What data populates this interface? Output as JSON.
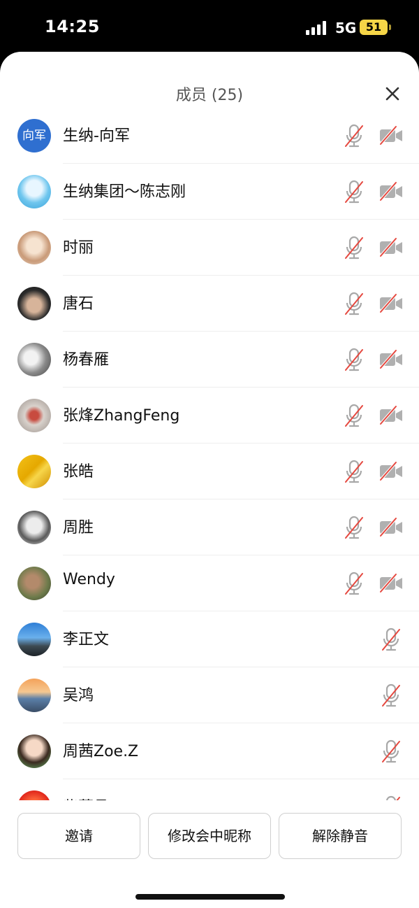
{
  "status_bar": {
    "time": "14:25",
    "network": "5G",
    "battery": "51"
  },
  "dialog": {
    "title": "成员 (25)"
  },
  "members": [
    {
      "name": "生纳-向军",
      "avatar_text": "向军",
      "mic": "muted",
      "camera": "off"
    },
    {
      "name": "生纳集团～陈志刚",
      "mic": "muted",
      "camera": "off"
    },
    {
      "name": "时丽",
      "mic": "muted",
      "camera": "off"
    },
    {
      "name": "唐石",
      "mic": "muted",
      "camera": "off"
    },
    {
      "name": "杨春雁",
      "mic": "muted",
      "camera": "off"
    },
    {
      "name": "张烽ZhangFeng",
      "mic": "muted",
      "camera": "off"
    },
    {
      "name": "张皓",
      "mic": "muted",
      "camera": "off"
    },
    {
      "name": "周胜",
      "mic": "muted",
      "camera": "off"
    },
    {
      "name": "Wendy",
      "mic": "muted",
      "camera": "off"
    },
    {
      "name": "李正文",
      "mic": "muted"
    },
    {
      "name": "吴鸿",
      "mic": "muted"
    },
    {
      "name": "周茜Zoe.Z",
      "mic": "muted"
    },
    {
      "name": "紫菜昌",
      "mic": "muted"
    }
  ],
  "footer": {
    "invite_label": "邀请",
    "rename_label": "修改会中昵称",
    "unmute_label": "解除静音"
  },
  "colors": {
    "muted_slash": "#e5483f",
    "icon_gray": "#a8a8a8",
    "avatar_blue": "#2f6fd0"
  }
}
